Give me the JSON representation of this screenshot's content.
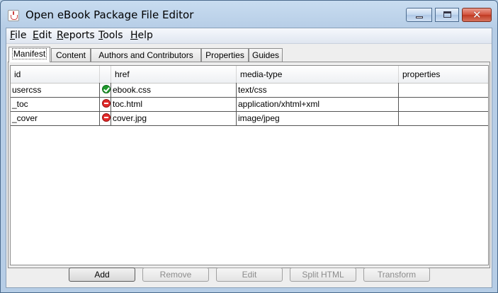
{
  "window": {
    "title": "Open eBook Package File Editor",
    "close_glyph": "✕"
  },
  "menu": [
    "File",
    "Edit",
    "Reports",
    "Tools",
    "Help"
  ],
  "tabs": [
    "Manifest",
    "Content",
    "Authors and Contributors",
    "Properties",
    "Guides"
  ],
  "active_tab": "Manifest",
  "table": {
    "columns": [
      "id",
      "",
      "href",
      "media-type",
      "properties"
    ],
    "rows": [
      {
        "id": "usercss",
        "status": "valid",
        "status_icon": "check-circle-icon",
        "href": "ebook.css",
        "media_type": "text/css",
        "properties": ""
      },
      {
        "id": "_toc",
        "status": "invalid",
        "status_icon": "no-entry-icon",
        "href": "toc.html",
        "media_type": "application/xhtml+xml",
        "properties": ""
      },
      {
        "id": "_cover",
        "status": "invalid",
        "status_icon": "no-entry-icon",
        "href": "cover.jpg",
        "media_type": "image/jpeg",
        "properties": ""
      }
    ]
  },
  "buttons": [
    {
      "label": "Add",
      "enabled": true
    },
    {
      "label": "Remove",
      "enabled": false
    },
    {
      "label": "Edit",
      "enabled": false
    },
    {
      "label": "Split HTML",
      "enabled": false
    },
    {
      "label": "Transform",
      "enabled": false
    }
  ],
  "colors": {
    "valid": "#1f9a2c",
    "invalid": "#e22a2a",
    "close_button": "#c03a22"
  }
}
